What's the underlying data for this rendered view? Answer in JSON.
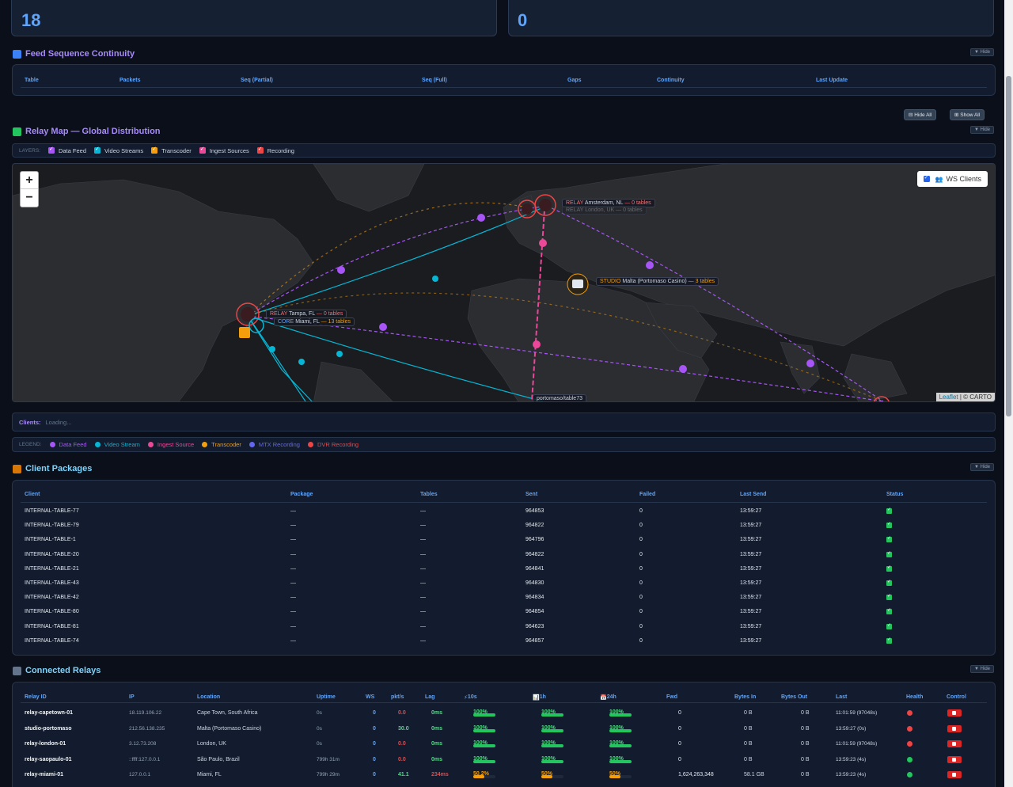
{
  "stats": [
    {
      "value": "18"
    },
    {
      "value": "0"
    }
  ],
  "feed_seq": {
    "title": "Feed Sequence Continuity",
    "hide": "▼ Hide",
    "columns": [
      "Table",
      "Packets",
      "Seq (Partial)",
      "Seq (Full)",
      "Gaps",
      "Continuity",
      "Last Update"
    ]
  },
  "map_controls": {
    "hide_all": "Hide All",
    "show_all": "Show All"
  },
  "relay_map": {
    "title": "Relay Map — Global Distribution",
    "hide": "▼ Hide",
    "layers_label": "LAYERS:",
    "layers": [
      {
        "label": "Data Feed",
        "color": "#a855f7"
      },
      {
        "label": "Video Streams",
        "color": "#06b6d4"
      },
      {
        "label": "Transcoder",
        "color": "#f59e0b"
      },
      {
        "label": "Ingest Sources",
        "color": "#ec4899"
      },
      {
        "label": "Recording",
        "color": "#ef4444"
      }
    ],
    "zoom_in": "+",
    "zoom_out": "−",
    "ws_clients": "WS Clients",
    "attribution_link": "Leaflet",
    "attribution_rest": "| © CARTO",
    "labels": {
      "amsterdam": {
        "kind": "RELAY",
        "name": "Amsterdam, NL",
        "count": "— 0 tables"
      },
      "london": {
        "text": "RELAY London, UK — 0 tables"
      },
      "malta": {
        "kind": "STUDIO",
        "name": "Malta (Portomaso Casino)",
        "count": "— 3 tables"
      },
      "tampa": {
        "kind": "RELAY",
        "name": "Tampa, FL",
        "count": "— 0 tables"
      },
      "miami": {
        "kind": "CORE",
        "name": "Miami, FL",
        "count": "— 13 tables"
      },
      "portomaso": {
        "text": "portomaso/table73"
      }
    }
  },
  "clients": {
    "label": "Clients:",
    "value": "Loading..."
  },
  "legend": {
    "label": "LEGEND:",
    "items": [
      {
        "label": "Data Feed",
        "color": "#a855f7"
      },
      {
        "label": "Video Stream",
        "color": "#06b6d4"
      },
      {
        "label": "Ingest Source",
        "color": "#ec4899"
      },
      {
        "label": "Transcoder",
        "color": "#f59e0b"
      },
      {
        "label": "MTX Recording",
        "color": "#6366f1"
      },
      {
        "label": "DVR Recording",
        "color": "#ef4444"
      }
    ]
  },
  "client_packages": {
    "title": "Client Packages",
    "hide": "▼ Hide",
    "columns": [
      "Client",
      "Package",
      "Tables",
      "Sent",
      "Failed",
      "Last Send",
      "Status"
    ],
    "rows": [
      {
        "client": "INTERNAL-TABLE-77",
        "package": "—",
        "tables": "—",
        "sent": "964853",
        "failed": "0",
        "last": "13:59:27"
      },
      {
        "client": "INTERNAL-TABLE-79",
        "package": "—",
        "tables": "—",
        "sent": "964822",
        "failed": "0",
        "last": "13:59:27"
      },
      {
        "client": "INTERNAL-TABLE-1",
        "package": "—",
        "tables": "—",
        "sent": "964796",
        "failed": "0",
        "last": "13:59:27"
      },
      {
        "client": "INTERNAL-TABLE-20",
        "package": "—",
        "tables": "—",
        "sent": "964822",
        "failed": "0",
        "last": "13:59:27"
      },
      {
        "client": "INTERNAL-TABLE-21",
        "package": "—",
        "tables": "—",
        "sent": "964841",
        "failed": "0",
        "last": "13:59:27"
      },
      {
        "client": "INTERNAL-TABLE-43",
        "package": "—",
        "tables": "—",
        "sent": "964830",
        "failed": "0",
        "last": "13:59:27"
      },
      {
        "client": "INTERNAL-TABLE-42",
        "package": "—",
        "tables": "—",
        "sent": "964834",
        "failed": "0",
        "last": "13:59:27"
      },
      {
        "client": "INTERNAL-TABLE-80",
        "package": "—",
        "tables": "—",
        "sent": "964854",
        "failed": "0",
        "last": "13:59:27"
      },
      {
        "client": "INTERNAL-TABLE-81",
        "package": "—",
        "tables": "—",
        "sent": "964623",
        "failed": "0",
        "last": "13:59:27"
      },
      {
        "client": "INTERNAL-TABLE-74",
        "package": "—",
        "tables": "—",
        "sent": "964857",
        "failed": "0",
        "last": "13:59:27"
      }
    ]
  },
  "relays": {
    "title": "Connected Relays",
    "hide": "▼ Hide",
    "columns": [
      "Relay ID",
      "IP",
      "Location",
      "Uptime",
      "WS",
      "pkt/s",
      "Lag",
      "10s",
      "1h",
      "24h",
      "Fwd",
      "Bytes In",
      "Bytes Out",
      "Last",
      "Health",
      "Control"
    ],
    "rows": [
      {
        "id": "relay-capetown-01",
        "ip": "18.119.106.22",
        "loc": "Cape Town, South Africa",
        "up": "0s",
        "ws": "0",
        "pkt": "0.0",
        "lag": "0ms",
        "s10": 100,
        "s10t": "100%",
        "h1": 100,
        "h1t": "100%",
        "h24": 100,
        "h24t": "100%",
        "fwd": "0",
        "bin": "0 B",
        "bout": "0 B",
        "last": "11:01:59 (97048s)",
        "health": "#ef4444"
      },
      {
        "id": "studio-portomaso",
        "ip": "212.56.138.235",
        "loc": "Malta (Portomaso Casino)",
        "up": "0s",
        "ws": "0",
        "pkt": "30.0",
        "lag": "0ms",
        "s10": 100,
        "s10t": "100%",
        "h1": 100,
        "h1t": "100%",
        "h24": 100,
        "h24t": "100%",
        "fwd": "0",
        "bin": "0 B",
        "bout": "0 B",
        "last": "13:59:27 (0s)",
        "health": "#ef4444"
      },
      {
        "id": "relay-london-01",
        "ip": "3.12.73.208",
        "loc": "London, UK",
        "up": "0s",
        "ws": "0",
        "pkt": "0.0",
        "lag": "0ms",
        "s10": 100,
        "s10t": "100%",
        "h1": 100,
        "h1t": "100%",
        "h24": 100,
        "h24t": "100%",
        "fwd": "0",
        "bin": "0 B",
        "bout": "0 B",
        "last": "11:01:59 (97048s)",
        "health": "#ef4444"
      },
      {
        "id": "relay-saopaulo-01",
        "ip": "::ffff:127.0.0.1",
        "loc": "São Paulo, Brazil",
        "up": "799h 31m",
        "ws": "0",
        "pkt": "0.0",
        "lag": "0ms",
        "s10": 100,
        "s10t": "100%",
        "h1": 100,
        "h1t": "100%",
        "h24": 100,
        "h24t": "100%",
        "fwd": "0",
        "bin": "0 B",
        "bout": "0 B",
        "last": "13:59:23 (4s)",
        "health": "#22c55e"
      },
      {
        "id": "relay-miami-01",
        "ip": "127.0.0.1",
        "loc": "Miami, FL",
        "up": "799h 29m",
        "ws": "0",
        "pkt": "41.1",
        "lag": "234ms",
        "s10": 50.2,
        "s10t": "50.2%",
        "h1": 50,
        "h1t": "50%",
        "h24": 50,
        "h24t": "50%",
        "fwd": "1,624,263,348",
        "bin": "58.1 GB",
        "bout": "0 B",
        "last": "13:59:23 (4s)",
        "health": "#22c55e"
      }
    ]
  }
}
